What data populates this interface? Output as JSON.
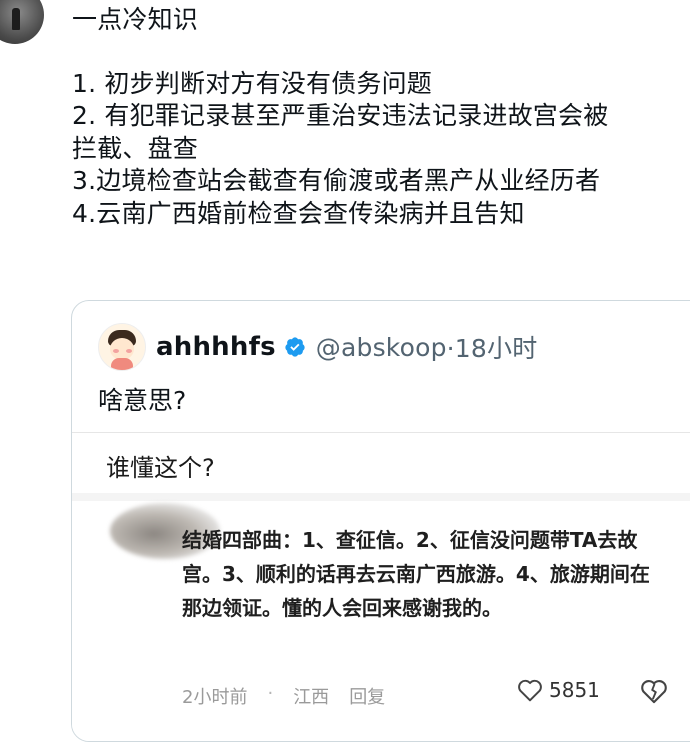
{
  "tweet": {
    "lines": [
      "一点冷知识",
      "",
      "1. 初步判断对方有没有债务问题",
      "2. 有犯罪记录甚至严重治安违法记录进故宫会被",
      "拦截、盘查",
      "3.边境检查站会截查有偷渡或者黑产从业经历者",
      "4.云南广西婚前检查会查传染病并且告知"
    ]
  },
  "quote": {
    "name": "ahhhhfs",
    "handle": "@abskoop",
    "time": "·18小时",
    "text": "啥意思?",
    "screenshot": {
      "title": "谁懂这个?",
      "body": "结婚四部曲：1、查征信。2、征信没问题带TA去故宫。3、顺利的话再去云南广西旅游。4、旅游期间在那边领证。懂的人会回来感谢我的。",
      "time": "2小时前",
      "dot": "·",
      "location": "江西",
      "reply": "回复",
      "likes": "5851"
    }
  },
  "colors": {
    "verified": "#1d9bf0",
    "handle": "#536471",
    "border": "#cfd9de"
  }
}
